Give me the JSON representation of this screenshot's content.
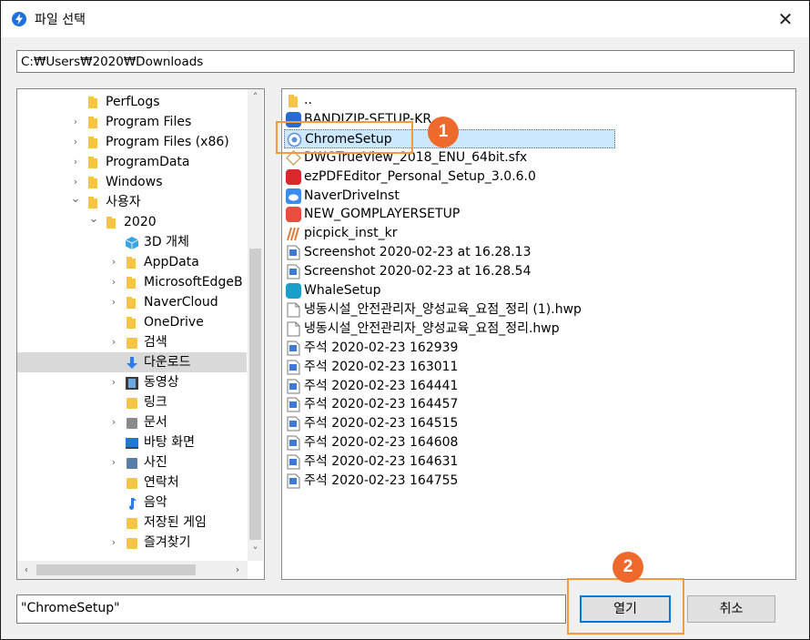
{
  "window": {
    "title": "파일 선택",
    "close_glyph": "✕"
  },
  "path": "C:₩Users₩2020₩Downloads",
  "tree": {
    "items": [
      {
        "label": "PerfLogs",
        "arrow": "",
        "icon": "folder-icon",
        "indent": 0
      },
      {
        "label": "Program Files",
        "arrow": "›",
        "icon": "folder-icon",
        "indent": 0
      },
      {
        "label": "Program Files (x86)",
        "arrow": "›",
        "icon": "folder-icon",
        "indent": 0
      },
      {
        "label": "ProgramData",
        "arrow": "›",
        "icon": "folder-icon",
        "indent": 0
      },
      {
        "label": "Windows",
        "arrow": "›",
        "icon": "folder-icon",
        "indent": 0
      },
      {
        "label": "사용자",
        "arrow": "⌄",
        "icon": "folder-icon",
        "indent": 0
      },
      {
        "label": "2020",
        "arrow": "⌄",
        "icon": "folder-icon",
        "indent": 1
      },
      {
        "label": "3D 개체",
        "arrow": "",
        "icon": "3d-objects-icon",
        "indent": 2
      },
      {
        "label": "AppData",
        "arrow": "›",
        "icon": "folder-icon",
        "indent": 2
      },
      {
        "label": "MicrosoftEdgeB",
        "arrow": "›",
        "icon": "folder-icon",
        "indent": 2
      },
      {
        "label": "NaverCloud",
        "arrow": "›",
        "icon": "folder-icon",
        "indent": 2
      },
      {
        "label": "OneDrive",
        "arrow": "",
        "icon": "folder-icon",
        "indent": 2
      },
      {
        "label": "검색",
        "arrow": "›",
        "icon": "search-folder-icon",
        "indent": 2
      },
      {
        "label": "다운로드",
        "arrow": "",
        "icon": "download-arrow-icon",
        "indent": 2,
        "selected": true
      },
      {
        "label": "동영상",
        "arrow": "›",
        "icon": "video-icon",
        "indent": 2
      },
      {
        "label": "링크",
        "arrow": "",
        "icon": "links-icon",
        "indent": 2
      },
      {
        "label": "문서",
        "arrow": "›",
        "icon": "documents-icon",
        "indent": 2
      },
      {
        "label": "바탕 화면",
        "arrow": "",
        "icon": "desktop-icon",
        "indent": 2
      },
      {
        "label": "사진",
        "arrow": "›",
        "icon": "pictures-icon",
        "indent": 2
      },
      {
        "label": "연락처",
        "arrow": "",
        "icon": "contacts-icon",
        "indent": 2
      },
      {
        "label": "음악",
        "arrow": "",
        "icon": "music-icon",
        "indent": 2
      },
      {
        "label": "저장된 게임",
        "arrow": "",
        "icon": "saved-games-icon",
        "indent": 2
      },
      {
        "label": "즐겨찾기",
        "arrow": "›",
        "icon": "favorites-icon",
        "indent": 2
      }
    ]
  },
  "files": [
    {
      "name": "..",
      "icon": "folder-icon",
      "color": "#f5c543"
    },
    {
      "name": "BANDIZIP-SETUP-KR",
      "icon": "bandizip-icon",
      "color": "#2a6ad3"
    },
    {
      "name": "ChromeSetup",
      "icon": "chrome-setup-icon",
      "color": "#5c8fdc",
      "selected": true
    },
    {
      "name": "DWGTrueView_2018_ENU_64bit.sfx",
      "icon": "dwg-icon",
      "color": "#c9a66b"
    },
    {
      "name": "ezPDFEditor_Personal_Setup_3.0.6.0",
      "icon": "ezpdf-icon",
      "color": "#d9272e"
    },
    {
      "name": "NaverDriveInst",
      "icon": "naver-drive-icon",
      "color": "#3a8df0"
    },
    {
      "name": "NEW_GOMPLAYERSETUP",
      "icon": "gomplayer-icon",
      "color": "#e84d3d"
    },
    {
      "name": "picpick_inst_kr",
      "icon": "picpick-icon",
      "color": "#e07b39"
    },
    {
      "name": "Screenshot 2020-02-23 at 16.28.13",
      "icon": "image-file-icon",
      "color": "#3b7bd6"
    },
    {
      "name": "Screenshot 2020-02-23 at 16.28.54",
      "icon": "image-file-icon",
      "color": "#3b7bd6"
    },
    {
      "name": "WhaleSetup",
      "icon": "whale-icon",
      "color": "#1aa0c8"
    },
    {
      "name": "냉동시설_안전관리자_양성교육_요점_정리 (1).hwp",
      "icon": "blank-file-icon",
      "color": "#ffffff"
    },
    {
      "name": "냉동시설_안전관리자_양성교육_요점_정리.hwp",
      "icon": "blank-file-icon",
      "color": "#ffffff"
    },
    {
      "name": "주석 2020-02-23 162939",
      "icon": "image-file-icon",
      "color": "#3b7bd6"
    },
    {
      "name": "주석 2020-02-23 163011",
      "icon": "image-file-icon",
      "color": "#3b7bd6"
    },
    {
      "name": "주석 2020-02-23 164441",
      "icon": "image-file-icon",
      "color": "#3b7bd6"
    },
    {
      "name": "주석 2020-02-23 164457",
      "icon": "image-file-icon",
      "color": "#3b7bd6"
    },
    {
      "name": "주석 2020-02-23 164515",
      "icon": "image-file-icon",
      "color": "#3b7bd6"
    },
    {
      "name": "주석 2020-02-23 164608",
      "icon": "image-file-icon",
      "color": "#3b7bd6"
    },
    {
      "name": "주석 2020-02-23 164631",
      "icon": "image-file-icon",
      "color": "#3b7bd6"
    },
    {
      "name": "주석 2020-02-23 164755",
      "icon": "image-file-icon",
      "color": "#3b7bd6"
    }
  ],
  "filename": "\"ChromeSetup\"",
  "buttons": {
    "open": "열기",
    "cancel": "취소"
  },
  "annotations": {
    "step1": "1",
    "step2": "2"
  },
  "colors": {
    "accent": "#0078d7",
    "highlight": "#f39a3a",
    "badge": "#ee6a2c",
    "selection": "#cce8ff"
  }
}
